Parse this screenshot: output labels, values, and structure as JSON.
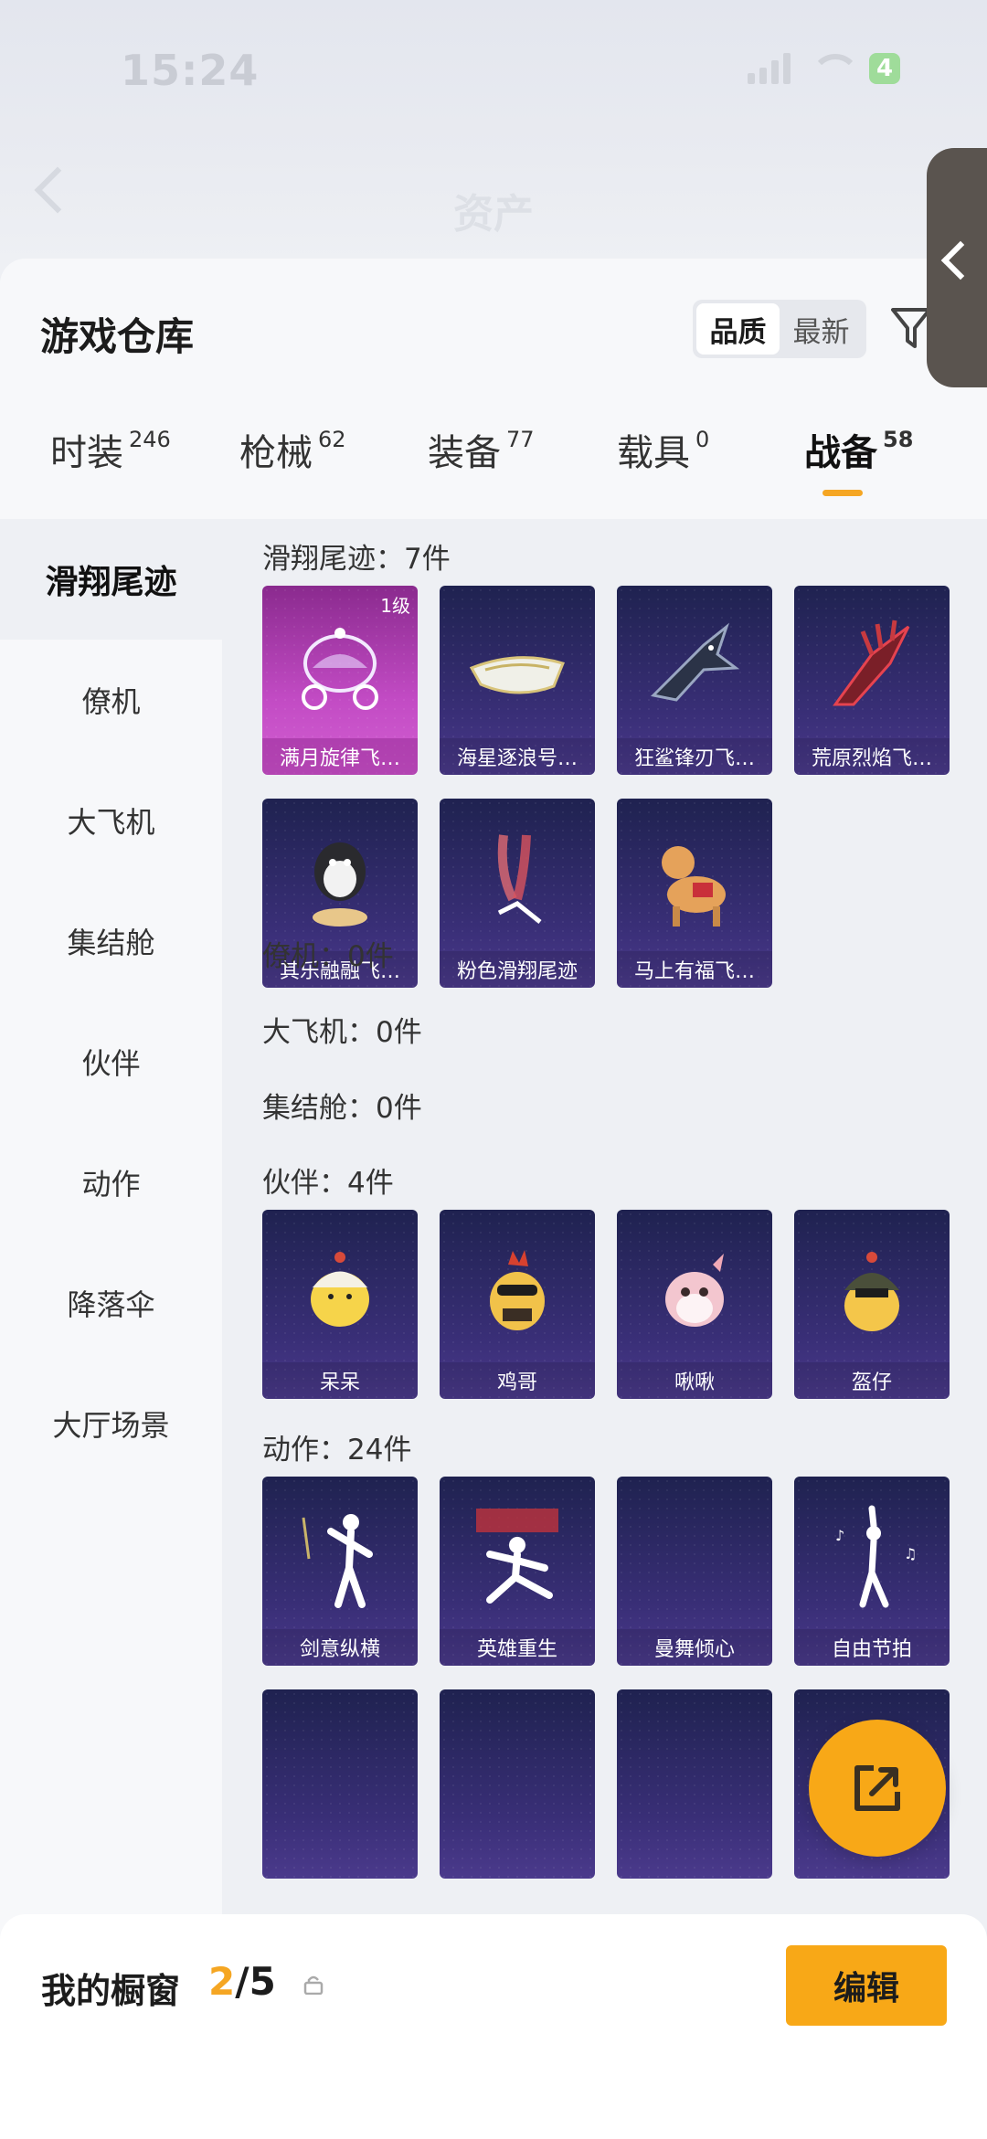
{
  "status_bar": {
    "time": "15:24",
    "battery": "4"
  },
  "nav": {
    "title": "资产"
  },
  "header": {
    "title": "游戏仓库",
    "sort_options": [
      "品质",
      "最新"
    ],
    "active_sort": "品质"
  },
  "tabs": [
    {
      "label": "时装",
      "count": "246"
    },
    {
      "label": "枪械",
      "count": "62"
    },
    {
      "label": "装备",
      "count": "77"
    },
    {
      "label": "载具",
      "count": "0"
    },
    {
      "label": "战备",
      "count": "58"
    }
  ],
  "active_tab": "战备",
  "categories": [
    "滑翔尾迹",
    "僚机",
    "大飞机",
    "集结舱",
    "伙伴",
    "动作",
    "降落伞",
    "大厅场景"
  ],
  "active_category": "滑翔尾迹",
  "sections": {
    "trail": {
      "label": "滑翔尾迹：7件",
      "items": [
        "满月旋律飞…",
        "海星逐浪号…",
        "狂鲨锋刃飞…",
        "荒原烈焰飞…",
        "其乐融融飞…",
        "粉色滑翔尾迹",
        "马上有福飞…"
      ],
      "first_badge": "1级"
    },
    "wingman": {
      "label": "僚机：0件"
    },
    "plane": {
      "label": "大飞机：0件"
    },
    "pod": {
      "label": "集结舱：0件"
    },
    "partner": {
      "label": "伙伴：4件",
      "items": [
        "呆呆",
        "鸡哥",
        "啾啾",
        "盔仔"
      ]
    },
    "action": {
      "label": "动作：24件",
      "items": [
        "剑意纵横",
        "英雄重生",
        "曼舞倾心",
        "自由节拍"
      ]
    }
  },
  "showcase": {
    "title": "我的橱窗",
    "current": "2",
    "total": "/5"
  },
  "edit_label": "编辑",
  "colors": {
    "accent": "#f8a817",
    "card_bg": "#2c2964",
    "card_highlight": "#c24bc4"
  }
}
